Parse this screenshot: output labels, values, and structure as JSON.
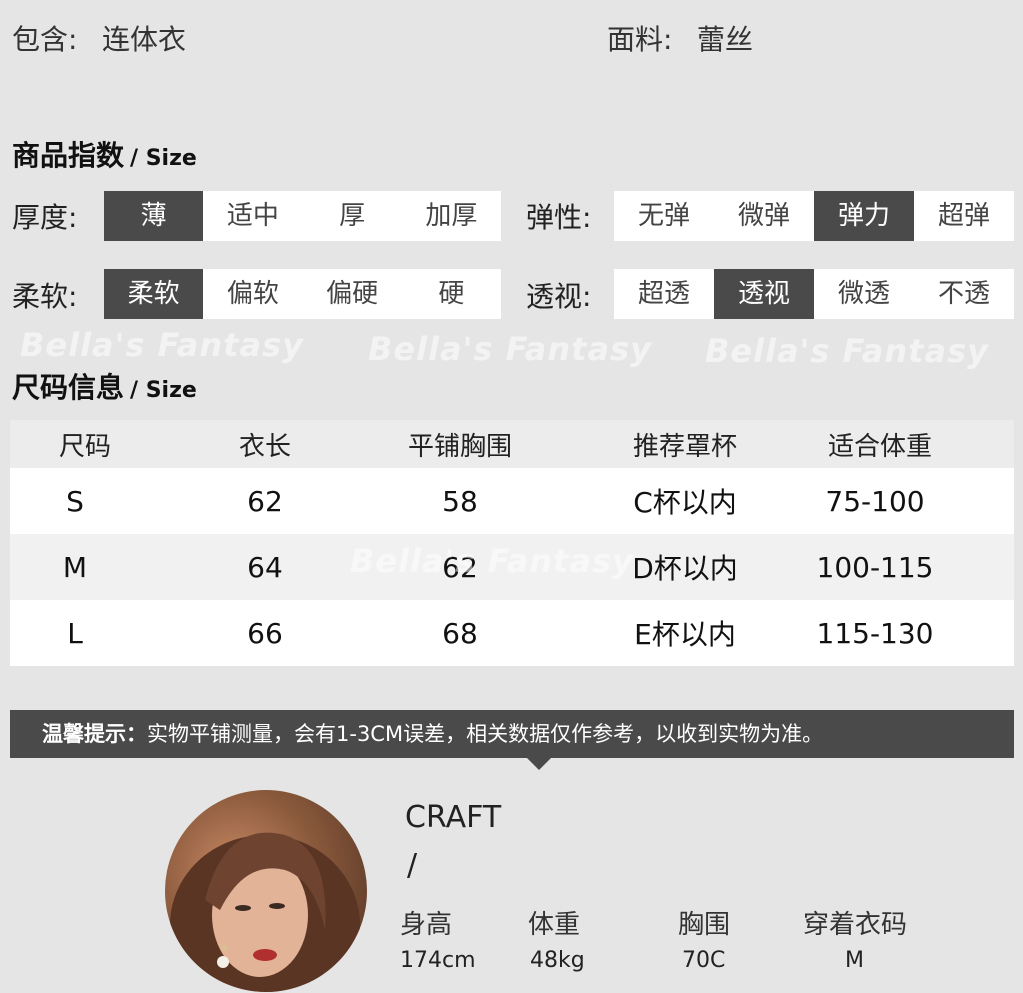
{
  "top": {
    "includes_label": "包含:",
    "includes_value": "连体衣",
    "fabric_label": "面料:",
    "fabric_value": "蕾丝"
  },
  "product_index": {
    "title": "商品指数",
    "subtitle": "/ Size",
    "thickness": {
      "label": "厚度:",
      "options": [
        "薄",
        "适中",
        "厚",
        "加厚"
      ],
      "selected": 0
    },
    "elasticity": {
      "label": "弹性:",
      "options": [
        "无弹",
        "微弹",
        "弹力",
        "超弹"
      ],
      "selected": 2
    },
    "softness": {
      "label": "柔软:",
      "options": [
        "柔软",
        "偏软",
        "偏硬",
        "硬"
      ],
      "selected": 0
    },
    "transparency": {
      "label": "透视:",
      "options": [
        "超透",
        "透视",
        "微透",
        "不透"
      ],
      "selected": 1
    }
  },
  "watermark": "Bella's Fantasy",
  "size_info": {
    "title": "尺码信息",
    "subtitle": "/ Size",
    "headers": [
      "尺码",
      "衣长",
      "平铺胸围",
      "推荐罩杯",
      "适合体重"
    ],
    "rows": [
      [
        "S",
        "62",
        "58",
        "C杯以内",
        "75-100"
      ],
      [
        "M",
        "64",
        "62",
        "D杯以内",
        "100-115"
      ],
      [
        "L",
        "66",
        "68",
        "E杯以内",
        "115-130"
      ]
    ]
  },
  "tip": {
    "title": "温馨提示：",
    "text": "实物平铺测量，会有1-3CM误差，相关数据仅作参考，以收到实物为准。"
  },
  "model": {
    "title": "CRAFT",
    "slash": "/",
    "labels": [
      "身高",
      "体重",
      "胸围",
      "穿着衣码"
    ],
    "values": [
      "174cm",
      "48kg",
      "70C",
      "M"
    ]
  },
  "colors": {
    "background": "#e5e5e5",
    "selected": "#4a4a4a",
    "option_bg": "#ffffff"
  }
}
